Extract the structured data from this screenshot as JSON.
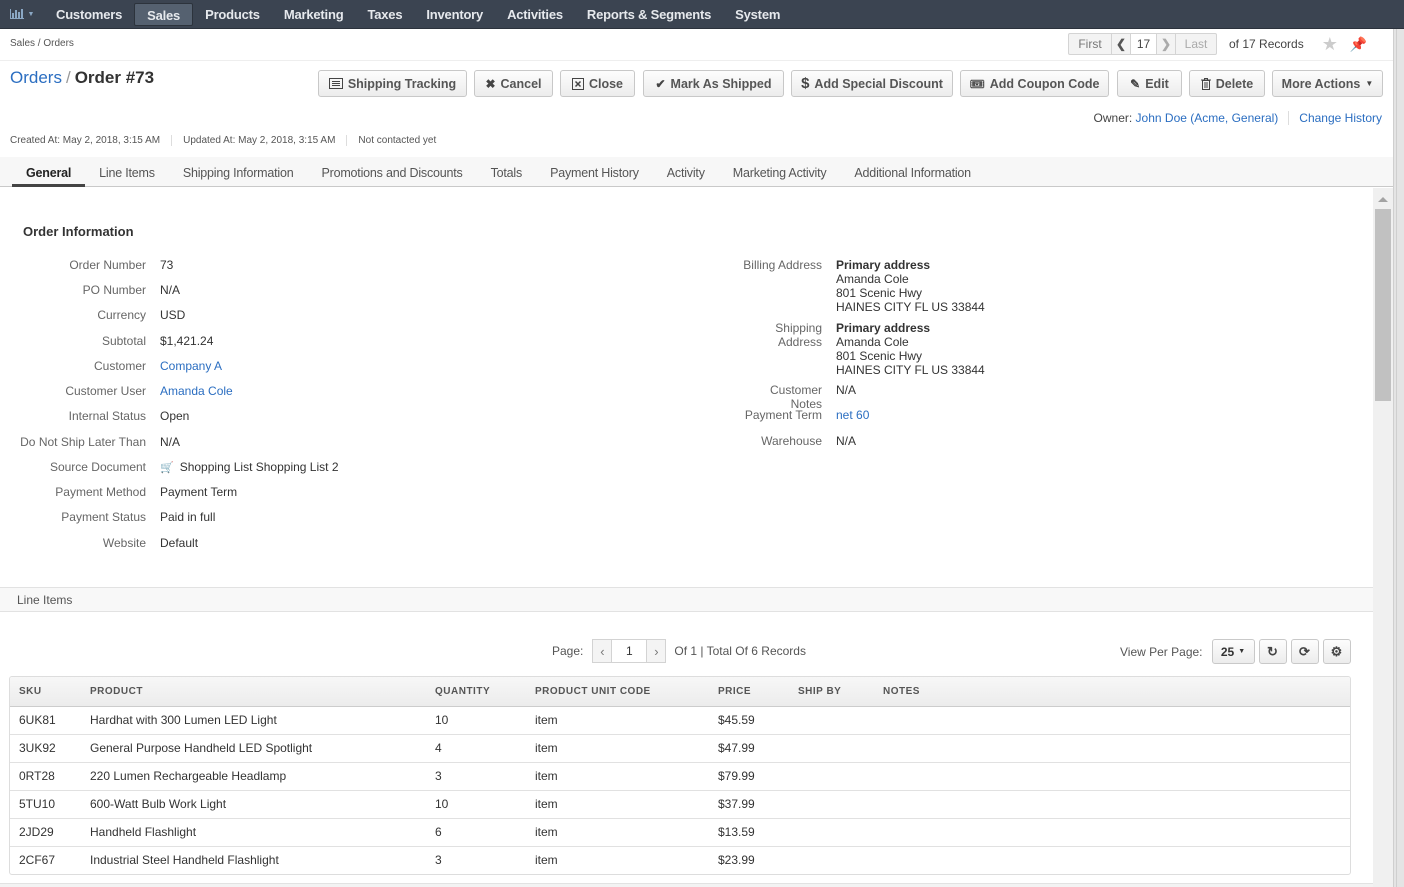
{
  "nav": {
    "dashboard_icon": "bar-chart-icon",
    "items": [
      {
        "label": "Customers",
        "active": false
      },
      {
        "label": "Sales",
        "active": true
      },
      {
        "label": "Products",
        "active": false
      },
      {
        "label": "Marketing",
        "active": false
      },
      {
        "label": "Taxes",
        "active": false
      },
      {
        "label": "Inventory",
        "active": false
      },
      {
        "label": "Activities",
        "active": false
      },
      {
        "label": "Reports & Segments",
        "active": false
      },
      {
        "label": "System",
        "active": false
      }
    ]
  },
  "breadcrumb": "Sales / Orders",
  "record_pager": {
    "first": "First",
    "current": "17",
    "last": "Last",
    "total": "of 17 Records"
  },
  "title": {
    "parent": "Orders",
    "separator": "/",
    "current": "Order #73"
  },
  "actions": [
    {
      "label": "Shipping Tracking",
      "icon": "list-icon"
    },
    {
      "label": "Cancel",
      "icon": "close-icon"
    },
    {
      "label": "Close",
      "icon": "close-box-icon"
    },
    {
      "label": "Mark As Shipped",
      "icon": "check-icon"
    },
    {
      "label": "Add Special Discount",
      "icon": "dollar-icon"
    },
    {
      "label": "Add Coupon Code",
      "icon": "ticket-icon"
    },
    {
      "label": "Edit",
      "icon": "pencil-icon"
    },
    {
      "label": "Delete",
      "icon": "trash-icon"
    },
    {
      "label": "More Actions",
      "icon": "caret-down-icon"
    }
  ],
  "meta": {
    "created": "Created At: May 2, 2018, 3:15 AM",
    "updated": "Updated At: May 2, 2018, 3:15 AM",
    "contacted": "Not contacted yet"
  },
  "owner": {
    "label": "Owner:",
    "value": "John Doe (Acme, General)",
    "history": "Change History"
  },
  "tabs": [
    {
      "label": "General",
      "active": true
    },
    {
      "label": "Line Items"
    },
    {
      "label": "Shipping Information"
    },
    {
      "label": "Promotions and Discounts"
    },
    {
      "label": "Totals"
    },
    {
      "label": "Payment History"
    },
    {
      "label": "Activity"
    },
    {
      "label": "Marketing Activity"
    },
    {
      "label": "Additional Information"
    }
  ],
  "order_info": {
    "title": "Order Information",
    "left": [
      {
        "label": "Order Number",
        "value": "73"
      },
      {
        "label": "PO Number",
        "value": "N/A"
      },
      {
        "label": "Currency",
        "value": "USD"
      },
      {
        "label": "Subtotal",
        "value": "$1,421.24"
      },
      {
        "label": "Customer",
        "value": "Company A",
        "link": true
      },
      {
        "label": "Customer User",
        "value": "Amanda Cole",
        "link": true
      },
      {
        "label": "Internal Status",
        "value": "Open"
      },
      {
        "label": "Do Not Ship Later Than",
        "value": "N/A"
      },
      {
        "label": "Source Document",
        "value": "Shopping List Shopping List 2"
      },
      {
        "label": "Payment Method",
        "value": "Payment Term"
      },
      {
        "label": "Payment Status",
        "value": "Paid in full"
      },
      {
        "label": "Website",
        "value": "Default"
      }
    ],
    "billing": {
      "label": "Billing Address",
      "title": "Primary address",
      "name": "Amanda Cole",
      "street": "801 Scenic Hwy",
      "city": "HAINES CITY FL US 33844"
    },
    "shipping": {
      "label": "Shipping Address",
      "title": "Primary address",
      "name": "Amanda Cole",
      "street": "801 Scenic Hwy",
      "city": "HAINES CITY FL US 33844"
    },
    "right": [
      {
        "label": "Customer Notes",
        "value": "N/A"
      },
      {
        "label": "Payment Term",
        "value": "net 60",
        "link": true
      },
      {
        "label": "Warehouse",
        "value": "N/A"
      }
    ]
  },
  "line_items": {
    "section_title": "Line Items",
    "pager": {
      "page_label": "Page:",
      "page": "1",
      "summary": "Of 1 | Total Of 6 Records"
    },
    "view_per_page": {
      "label": "View Per Page:",
      "value": "25"
    },
    "columns": [
      "SKU",
      "PRODUCT",
      "QUANTITY",
      "PRODUCT UNIT CODE",
      "PRICE",
      "SHIP BY",
      "NOTES"
    ],
    "rows": [
      [
        "6UK81",
        "Hardhat with 300 Lumen LED Light",
        "10",
        "item",
        "$45.59",
        "",
        ""
      ],
      [
        "3UK92",
        "General Purpose Handheld LED Spotlight",
        "4",
        "item",
        "$47.99",
        "",
        ""
      ],
      [
        "0RT28",
        "220 Lumen Rechargeable Headlamp",
        "3",
        "item",
        "$79.99",
        "",
        ""
      ],
      [
        "5TU10",
        "600-Watt Bulb Work Light",
        "10",
        "item",
        "$37.99",
        "",
        ""
      ],
      [
        "2JD29",
        "Handheld Flashlight",
        "6",
        "item",
        "$13.59",
        "",
        ""
      ],
      [
        "2CF67",
        "Industrial Steel Handheld Flashlight",
        "3",
        "item",
        "$23.99",
        "",
        ""
      ]
    ]
  }
}
